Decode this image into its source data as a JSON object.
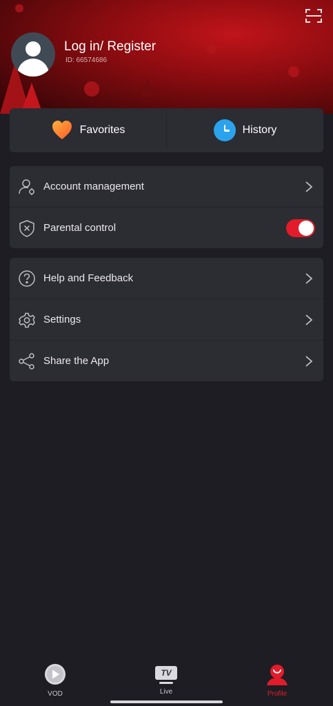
{
  "header": {
    "login_text": "Log in/ Register",
    "user_id": "ID: 66574686",
    "scan_icon": "scan-icon"
  },
  "quick": {
    "favorites": "Favorites",
    "history": "History"
  },
  "menu1": [
    {
      "label": "Account management",
      "icon": "account-icon"
    },
    {
      "label": "Parental control",
      "icon": "shield-icon",
      "toggle": true
    }
  ],
  "menu2": [
    {
      "label": "Help and Feedback",
      "icon": "help-icon"
    },
    {
      "label": "Settings",
      "icon": "gear-icon"
    },
    {
      "label": "Share the App",
      "icon": "share-icon"
    }
  ],
  "tabs": [
    {
      "label": "VOD",
      "icon": "play-icon"
    },
    {
      "label": "Live",
      "icon": "tv-icon",
      "badge": "TV"
    },
    {
      "label": "Profile",
      "icon": "profile-icon",
      "active": true
    }
  ],
  "colors": {
    "accent": "#e21c2a",
    "background": "#1d1d23",
    "card": "#2c2c33",
    "history_icon": "#2ba3ec"
  }
}
